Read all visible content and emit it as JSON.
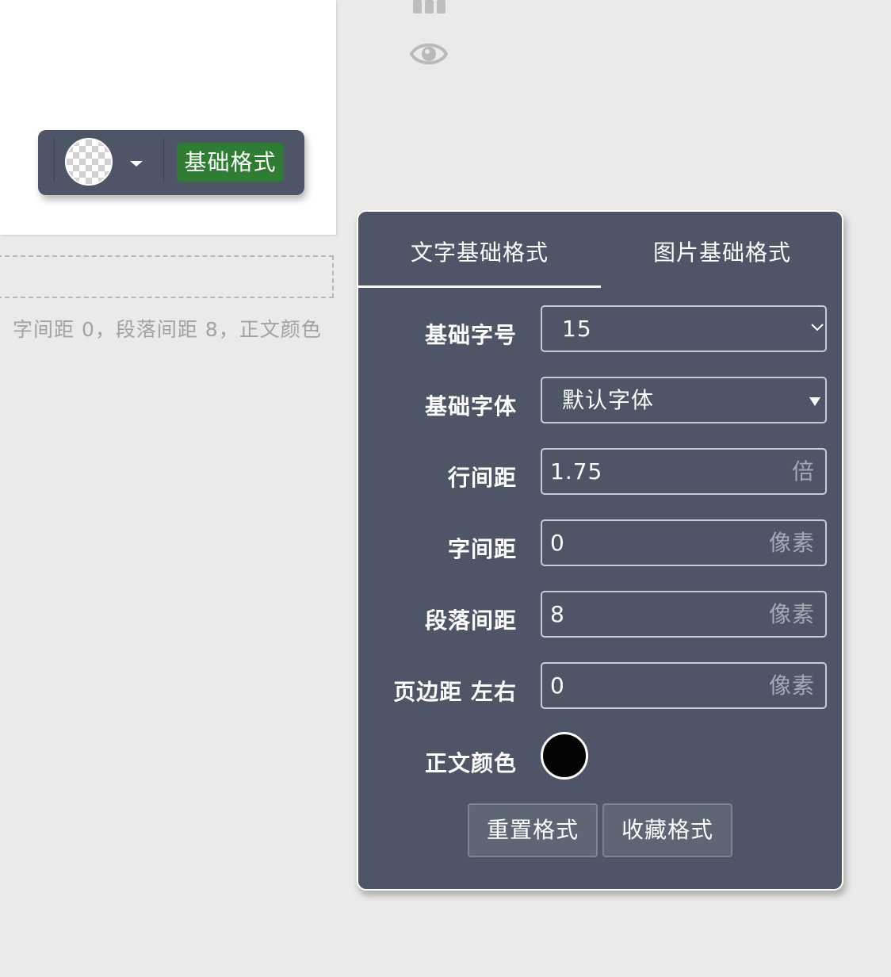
{
  "canvas": {
    "toolbar": {
      "color_swatch_icon": "transparent-checker",
      "dropdown_icon": "caret-down-icon",
      "format_button_label": "基础格式",
      "format_button_color": "#2e7d32"
    },
    "summary_text": "字间距 0，段落间距 8，正文颜色"
  },
  "sidebar": {
    "icons": [
      "bar-chart-icon",
      "eye-icon"
    ]
  },
  "format_panel": {
    "tabs": [
      {
        "label": "文字基础格式",
        "active": true
      },
      {
        "label": "图片基础格式",
        "active": false
      }
    ],
    "fields": {
      "font_size": {
        "label": "基础字号",
        "value": "15"
      },
      "font_family": {
        "label": "基础字体",
        "value": "默认字体"
      },
      "line_height": {
        "label": "行间距",
        "value": "1.75",
        "unit": "倍"
      },
      "letter_spacing": {
        "label": "字间距",
        "value": "0",
        "unit": "像素"
      },
      "paragraph_spacing": {
        "label": "段落间距",
        "value": "8",
        "unit": "像素"
      },
      "page_margin": {
        "label": "页边距 左右",
        "value": "0",
        "unit": "像素"
      },
      "body_color": {
        "label": "正文颜色",
        "color": "#050505"
      }
    },
    "buttons": {
      "reset_label": "重置格式",
      "save_label": "收藏格式"
    },
    "colors": {
      "panel_bg": "#4e5566",
      "page_bg": "#ebeae8"
    }
  }
}
